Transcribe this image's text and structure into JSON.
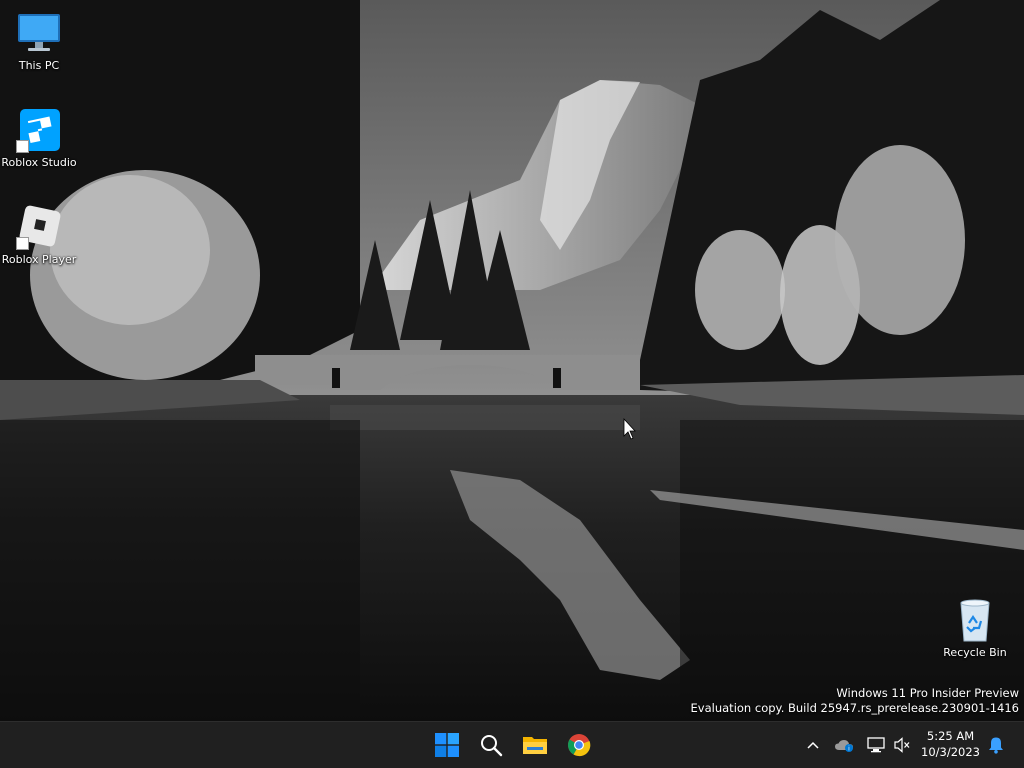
{
  "desktop": {
    "icons": [
      {
        "label": "This PC",
        "icon": "monitor-icon"
      },
      {
        "label": "Roblox Studio",
        "icon": "roblox-studio-icon"
      },
      {
        "label": "Roblox Player",
        "icon": "roblox-player-icon"
      },
      {
        "label": "Recycle Bin",
        "icon": "recycle-bin-icon"
      }
    ],
    "watermark": {
      "line1": "Windows 11 Pro Insider Preview",
      "line2": "Evaluation copy. Build 25947.rs_prerelease.230901-1416"
    }
  },
  "taskbar": {
    "pinned": [
      {
        "name": "Start",
        "icon": "windows-start-icon"
      },
      {
        "name": "Search",
        "icon": "search-icon"
      },
      {
        "name": "File Explorer",
        "icon": "folder-icon"
      },
      {
        "name": "Google Chrome",
        "icon": "chrome-icon"
      }
    ],
    "tray": {
      "icons": [
        "chevron-up-icon",
        "onedrive-icon",
        "network-icon",
        "volume-muted-icon",
        "notification-bell-icon"
      ],
      "time": "5:25 AM",
      "date": "10/3/2023"
    }
  },
  "colors": {
    "taskbar_bg": "#202020",
    "accent_blue": "#0078d4"
  }
}
